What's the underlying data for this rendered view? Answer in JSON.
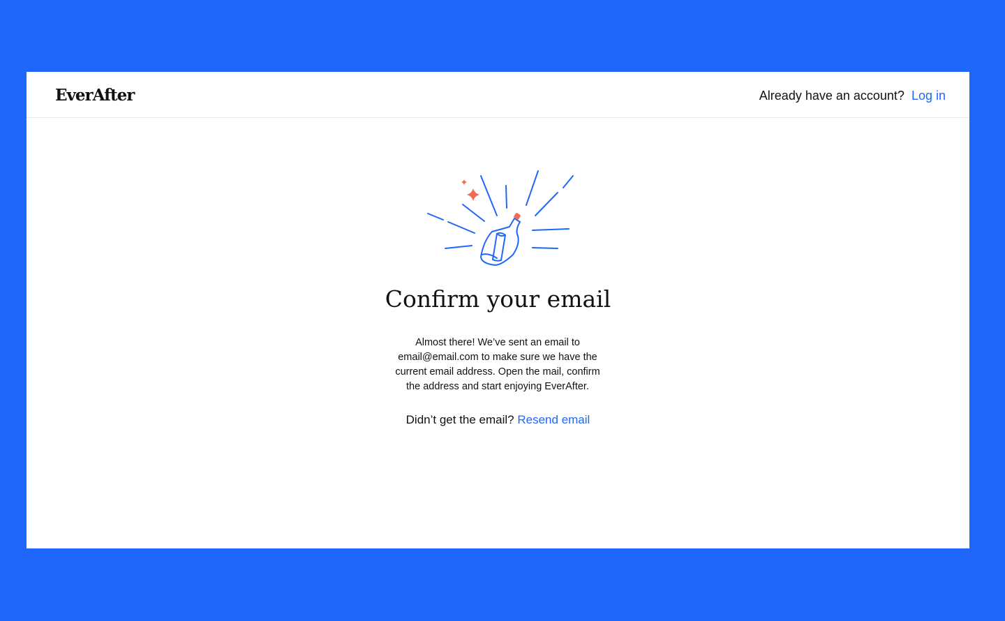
{
  "header": {
    "logo": "EverAfter",
    "prompt": "Already have an account?",
    "login_label": "Log in"
  },
  "main": {
    "title": "Confirm your email",
    "message": "Almost there! We’ve sent an email to email@email.com to make sure we have the current email address. Open the mail, confirm the address and start enjoying EverAfter.",
    "resend_prompt": "Didn’t get the email?",
    "resend_label": "Resend email"
  },
  "colors": {
    "accent": "#1f66fa",
    "highlight": "#f26b50"
  }
}
